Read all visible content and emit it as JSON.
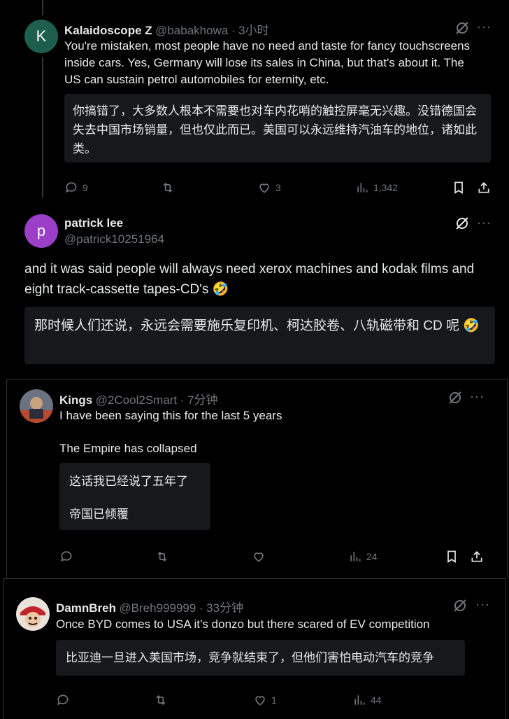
{
  "tweets": [
    {
      "avatar_letter": "K",
      "avatar_color": "#1d5e4c",
      "name": "Kalaidoscope Z",
      "handle": "@babakhowa",
      "time": "· 3小时",
      "text": "You're mistaken, most people have no need and taste for fancy touchscreens inside cars. Yes, Germany will lose its sales in China, but that's about it. The US can sustain petrol automobiles for eternity, etc.",
      "translation": "你搞错了，大多数人根本不需要也对车内花哨的触控屏毫无兴趣。没错德国会失去中国市场销量，但也仅此而已。美国可以永远维持汽油车的地位，诸如此类。",
      "replies": "9",
      "likes": "3",
      "views": "1,342"
    },
    {
      "avatar_letter": "p",
      "avatar_color": "#9b3fc9",
      "name": "patrick lee",
      "handle": "@patrick10251964",
      "text": "and it was said people will always need xerox machines and kodak films and eight track-cassette tapes-CD's 🤣",
      "translation": "那时候人们还说，永远会需要施乐复印机、柯达胶卷、八轨磁带和 CD 呢 🤣"
    },
    {
      "name": "Kings",
      "handle": "@2Cool2Smart",
      "time": "· 7分钟",
      "text_line1": "I have been saying this for the last 5 years",
      "text_line2": "The Empire has collapsed",
      "translation_line1": "这话我已经说了五年了",
      "translation_line2": "帝国已倾覆",
      "views": "24"
    },
    {
      "name": "DamnBreh",
      "handle": "@Breh999999",
      "time": "· 33分钟",
      "text": "Once BYD comes to USA it’s donzo but there scared of EV competition",
      "translation": "比亚迪一旦进入美国市场，竞争就结束了，但他们害怕电动汽车的竞争",
      "likes": "1",
      "views": "44"
    }
  ],
  "more_label": "···"
}
